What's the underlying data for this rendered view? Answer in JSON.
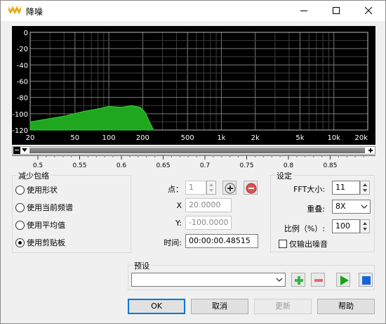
{
  "window": {
    "title": "降噪"
  },
  "spectrum": {
    "y_ticks": [
      "0",
      "-20",
      "-40",
      "-60",
      "-80",
      "-100",
      "-120"
    ],
    "x_ticks": [
      "20",
      "50",
      "100",
      "200",
      "500",
      "1k",
      "2k",
      "5k",
      "10k",
      "20k"
    ],
    "ruler_ticks": [
      "0.5",
      "0.55",
      "0.6",
      "0.65",
      "0.7",
      "0.75",
      "0.8",
      "0.85"
    ],
    "curve_color": "#1fa81f",
    "grid_color": "#7a7a7a"
  },
  "reduce_envelope": {
    "legend": "减少包络",
    "options": [
      {
        "label": "使用形状",
        "selected": false
      },
      {
        "label": "使用当前频谱",
        "selected": false
      },
      {
        "label": "使用平均值",
        "selected": false
      },
      {
        "label": "使用剪贴板",
        "selected": true
      }
    ]
  },
  "point": {
    "label": "点：",
    "value": "1",
    "x_label": "X",
    "x_value": "20.0000",
    "y_label": "Y:",
    "y_value": "-100.0000",
    "time_label": "时间:",
    "time_value": "00:00:00.48515"
  },
  "settings": {
    "legend": "设定",
    "fft_label": "FFT大小:",
    "fft_value": "11",
    "overlap_label": "重叠:",
    "overlap_value": "8X",
    "ratio_label": "比例（%）:",
    "ratio_value": "100",
    "noise_only_label": "仅输出噪音",
    "noise_only_checked": false
  },
  "preset": {
    "legend": "预设",
    "value": ""
  },
  "buttons": {
    "ok": "OK",
    "cancel": "取消",
    "update": "更新",
    "help": "帮助"
  }
}
